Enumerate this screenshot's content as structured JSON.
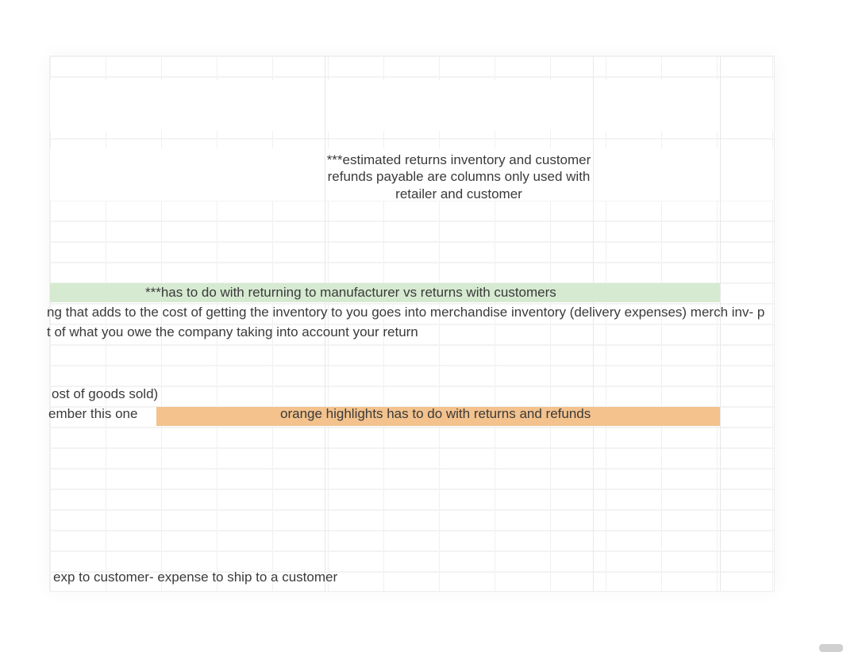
{
  "note_top": "***estimated returns inventory and customer refunds payable are columns only used with retailer and customer",
  "green_text": "***has to do with returning to manufacturer vs returns with customers",
  "longline_1": "ng that adds to the cost of getting the inventory to you goes into merchandise inventory (delivery expenses) merch inv- p",
  "longline_2": "t of what you owe the company taking into account your return",
  "cogs_fragment": "ost of goods sold)",
  "ember_fragment": "ember this one",
  "orange_text": "orange highlights has to do with returns and refunds",
  "ship_text": "exp to customer- expense to ship to a customer",
  "colors": {
    "green_highlight": "#d6ead1",
    "orange_highlight": "#f3c28d"
  }
}
